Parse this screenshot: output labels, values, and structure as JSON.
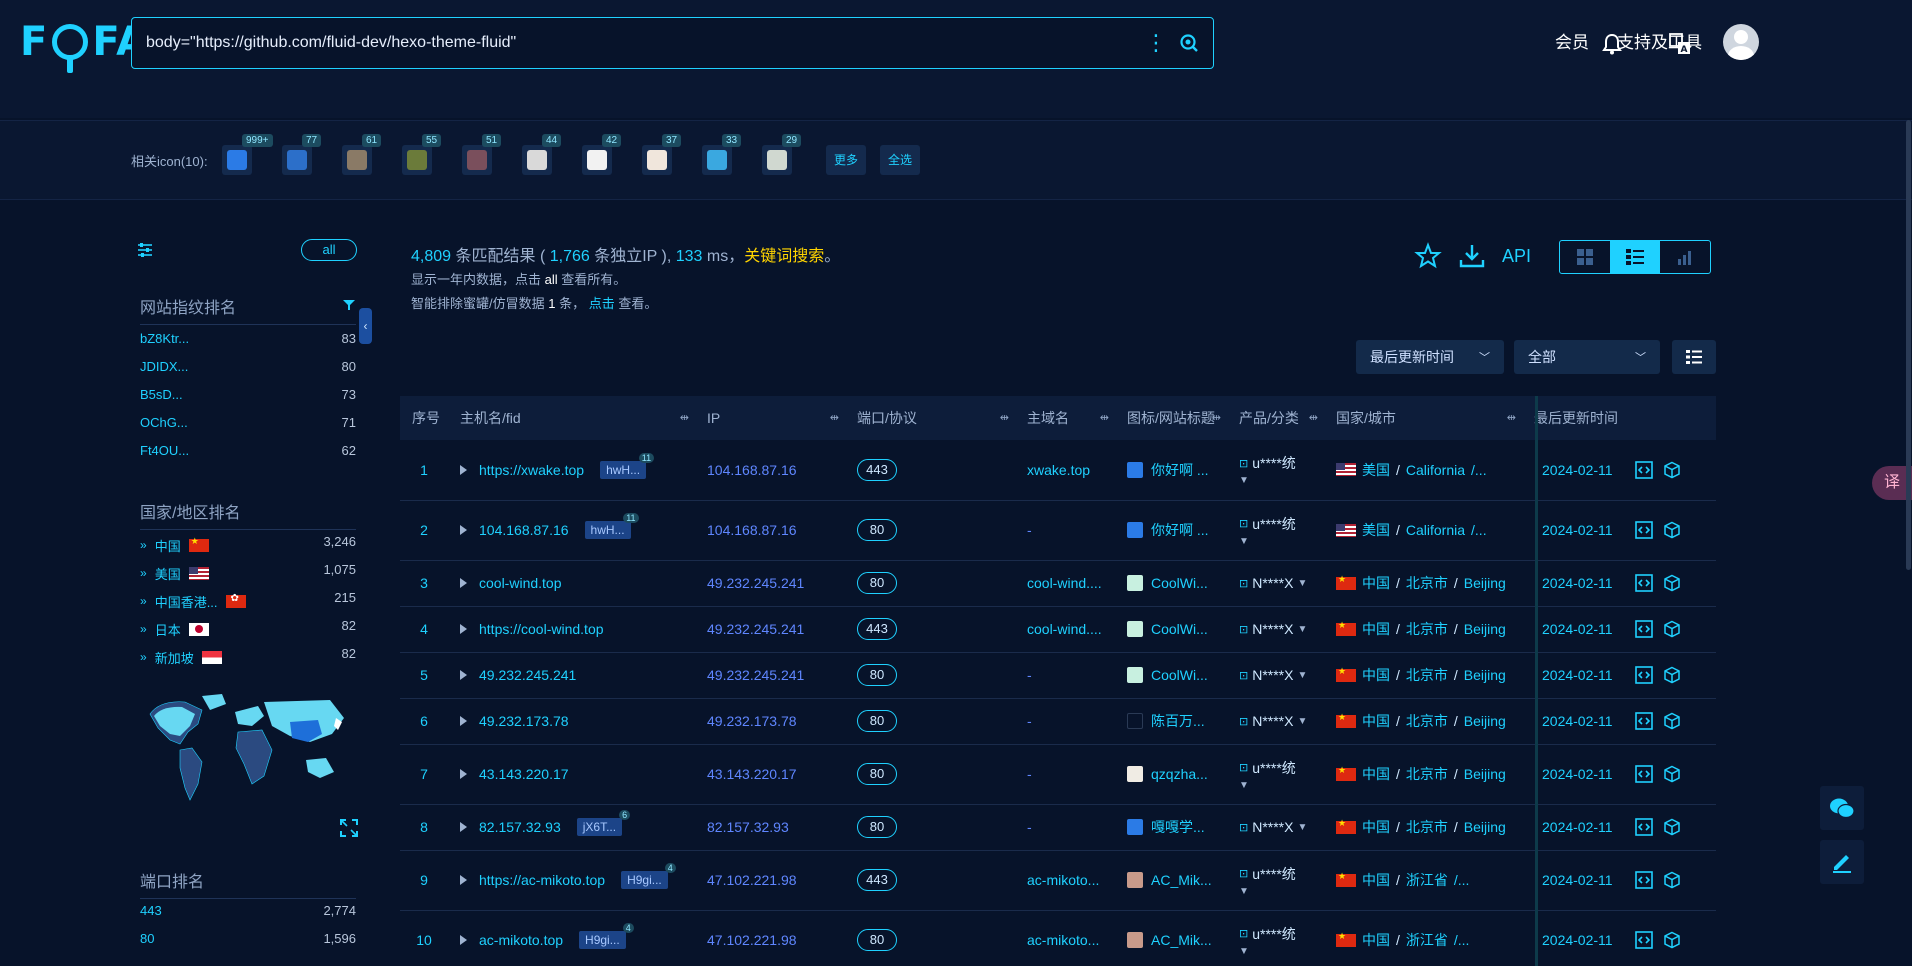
{
  "brand": "FOFA",
  "search": {
    "query": "body=\"https://github.com/fluid-dev/hexo-theme-fluid\""
  },
  "nav": {
    "member": "会员",
    "tools": "支持及工具"
  },
  "icon_bar": {
    "label": "相关icon(10):",
    "icons": [
      {
        "count": "999+",
        "color": "#2b7be6",
        "name": "fluid-favicon"
      },
      {
        "count": "77",
        "color": "#2c6fc9",
        "name": "h-favicon"
      },
      {
        "count": "61",
        "color": "#8a7a66",
        "name": "person-favicon"
      },
      {
        "count": "55",
        "color": "#6b7b3a",
        "name": "plant-favicon"
      },
      {
        "count": "51",
        "color": "#7a4f5c",
        "name": "anime-favicon"
      },
      {
        "count": "44",
        "color": "#d9d9d9",
        "name": "x-favicon"
      },
      {
        "count": "42",
        "color": "#f2f2f2",
        "name": "doc-favicon"
      },
      {
        "count": "37",
        "color": "#f0e6dc",
        "name": "coffee-favicon"
      },
      {
        "count": "33",
        "color": "#3aa8e0",
        "name": "circle-favicon"
      },
      {
        "count": "29",
        "color": "#d0d8d0",
        "name": "qr-favicon"
      }
    ],
    "more": "更多",
    "select_all": "全选"
  },
  "sidebar": {
    "all": "all",
    "fingerprint_title": "网站指纹排名",
    "fingerprints": [
      {
        "name": "bZ8Ktr...",
        "value": "83"
      },
      {
        "name": "JDIDX...",
        "value": "80"
      },
      {
        "name": "B5sD...",
        "value": "73"
      },
      {
        "name": "OChG...",
        "value": "71"
      },
      {
        "name": "Ft4OU...",
        "value": "62"
      }
    ],
    "country_title": "国家/地区排名",
    "countries": [
      {
        "name": "中国",
        "flag": "cn",
        "value": "3,246"
      },
      {
        "name": "美国",
        "flag": "us",
        "value": "1,075"
      },
      {
        "name": "中国香港...",
        "flag": "hk",
        "value": "215"
      },
      {
        "name": "日本",
        "flag": "jp",
        "value": "82"
      },
      {
        "name": "新加坡",
        "flag": "sg",
        "value": "82"
      }
    ],
    "port_title": "端口排名",
    "ports": [
      {
        "name": "443",
        "value": "2,774"
      },
      {
        "name": "80",
        "value": "1,596"
      }
    ]
  },
  "summary": {
    "total": "4,809",
    "total_label": "条匹配结果 (",
    "unique_ip": "1,766",
    "unique_label": "条独立IP ),",
    "ms": "133",
    "ms_label": "ms，",
    "keyword": "关键词搜索",
    "period": "。",
    "line2_pre": "显示一年内数据，点击",
    "line2_all": "all",
    "line2_post": "查看所有。",
    "line3_pre": "智能排除蜜罐/仿冒数据",
    "line3_num": "1",
    "line3_mid": "条，",
    "line3_link": "点击",
    "line3_post": "查看。"
  },
  "toolbar": {
    "api": "API",
    "sort": "最后更新时间",
    "filter": "全部"
  },
  "table": {
    "headers": [
      "序号",
      "主机名/fid",
      "IP",
      "端口/协议",
      "主域名",
      "图标/网站标题",
      "产品/分类",
      "国家/城市",
      "最后更新时间"
    ],
    "rows": [
      {
        "seq": "1",
        "host": "https://xwake.top",
        "fid": "hwH...",
        "fid_count": "11",
        "ip": "104.168.87.16",
        "port": "443",
        "domain": "xwake.top",
        "fav": "#2b7be6",
        "title": "你好啊 ...",
        "product": "u****统",
        "product_dd": true,
        "flag": "us",
        "country": "美国",
        "region": "California",
        "city": "/...",
        "date": "2024-02-11"
      },
      {
        "seq": "2",
        "host": "104.168.87.16",
        "fid": "hwH...",
        "fid_count": "11",
        "ip": "104.168.87.16",
        "port": "80",
        "domain": "-",
        "fav": "#2b7be6",
        "title": "你好啊 ...",
        "product": "u****统",
        "product_dd": true,
        "flag": "us",
        "country": "美国",
        "region": "California",
        "city": "/...",
        "date": "2024-02-11"
      },
      {
        "seq": "3",
        "host": "cool-wind.top",
        "fid": "",
        "fid_count": "",
        "ip": "49.232.245.241",
        "port": "80",
        "domain": "cool-wind....",
        "fav": "#c8f0e0",
        "title": "CoolWi...",
        "product": "N****X",
        "product_dd": false,
        "flag": "cn",
        "country": "中国",
        "region": "北京市",
        "city": "Beijing",
        "date": "2024-02-11"
      },
      {
        "seq": "4",
        "host": "https://cool-wind.top",
        "fid": "",
        "fid_count": "",
        "ip": "49.232.245.241",
        "port": "443",
        "domain": "cool-wind....",
        "fav": "#c8f0e0",
        "title": "CoolWi...",
        "product": "N****X",
        "product_dd": false,
        "flag": "cn",
        "country": "中国",
        "region": "北京市",
        "city": "Beijing",
        "date": "2024-02-11"
      },
      {
        "seq": "5",
        "host": "49.232.245.241",
        "fid": "",
        "fid_count": "",
        "ip": "49.232.245.241",
        "port": "80",
        "domain": "-",
        "fav": "#c8f0e0",
        "title": "CoolWi...",
        "product": "N****X",
        "product_dd": false,
        "flag": "cn",
        "country": "中国",
        "region": "北京市",
        "city": "Beijing",
        "date": "2024-02-11"
      },
      {
        "seq": "6",
        "host": "49.232.173.78",
        "fid": "",
        "fid_count": "",
        "ip": "49.232.173.78",
        "port": "80",
        "domain": "-",
        "fav": "#07132a",
        "title": "陈百万...",
        "product": "N****X",
        "product_dd": false,
        "flag": "cn",
        "country": "中国",
        "region": "北京市",
        "city": "Beijing",
        "date": "2024-02-11"
      },
      {
        "seq": "7",
        "host": "43.143.220.17",
        "fid": "",
        "fid_count": "",
        "ip": "43.143.220.17",
        "port": "80",
        "domain": "-",
        "fav": "#f0ece4",
        "title": "qzqzha...",
        "product": "u****统",
        "product_dd": true,
        "flag": "cn",
        "country": "中国",
        "region": "北京市",
        "city": "Beijing",
        "date": "2024-02-11"
      },
      {
        "seq": "8",
        "host": "82.157.32.93",
        "fid": "jX6T...",
        "fid_count": "6",
        "ip": "82.157.32.93",
        "port": "80",
        "domain": "-",
        "fav": "#2b7be6",
        "title": "嘎嘎学...",
        "product": "N****X",
        "product_dd": false,
        "flag": "cn",
        "country": "中国",
        "region": "北京市",
        "city": "Beijing",
        "date": "2024-02-11"
      },
      {
        "seq": "9",
        "host": "https://ac-mikoto.top",
        "fid": "H9gi...",
        "fid_count": "4",
        "ip": "47.102.221.98",
        "port": "443",
        "domain": "ac-mikoto...",
        "fav": "#c89a8a",
        "title": "AC_Mik...",
        "product": "u****统",
        "product_dd": true,
        "flag": "cn",
        "country": "中国",
        "region": "浙江省",
        "city": "/...",
        "date": "2024-02-11"
      },
      {
        "seq": "10",
        "host": "ac-mikoto.top",
        "fid": "H9gi...",
        "fid_count": "4",
        "ip": "47.102.221.98",
        "port": "80",
        "domain": "ac-mikoto...",
        "fav": "#c89a8a",
        "title": "AC_Mik...",
        "product": "u****统",
        "product_dd": true,
        "flag": "cn",
        "country": "中国",
        "region": "浙江省",
        "city": "/...",
        "date": "2024-02-11"
      }
    ]
  }
}
